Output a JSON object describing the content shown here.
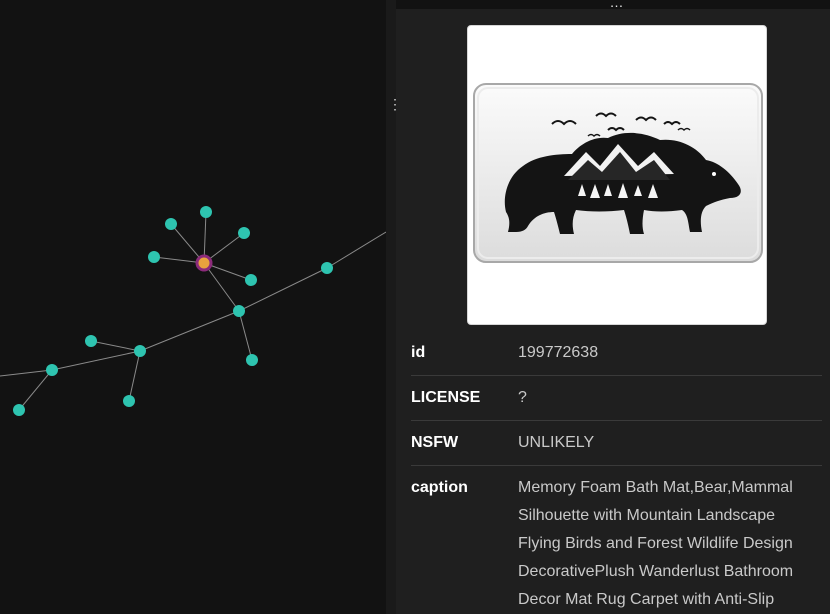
{
  "splitter": {
    "handle_icon": "⋮"
  },
  "panel": {
    "menu_icon": "…"
  },
  "record": {
    "image_alt": "Memory Foam Bath Mat with bear silhouette and mountain landscape",
    "fields": [
      {
        "key": "id",
        "value": "199772638"
      },
      {
        "key": "LICENSE",
        "value": "?"
      },
      {
        "key": "NSFW",
        "value": "UNLIKELY"
      },
      {
        "key": "caption",
        "value": "Memory Foam Bath Mat,Bear,Mammal Silhouette with Mountain Landscape Flying Birds and Forest Wildlife Design DecorativePlush Wanderlust Bathroom Decor Mat Rug Carpet with Anti-Slip"
      }
    ]
  },
  "colors": {
    "background": "#121212",
    "panel": "#1f1f1f",
    "node": "#2ec4b0",
    "selected_node_fill": "#e8a33d",
    "selected_node_ring": "#8b2a7a",
    "edge": "#8a8a8a"
  }
}
